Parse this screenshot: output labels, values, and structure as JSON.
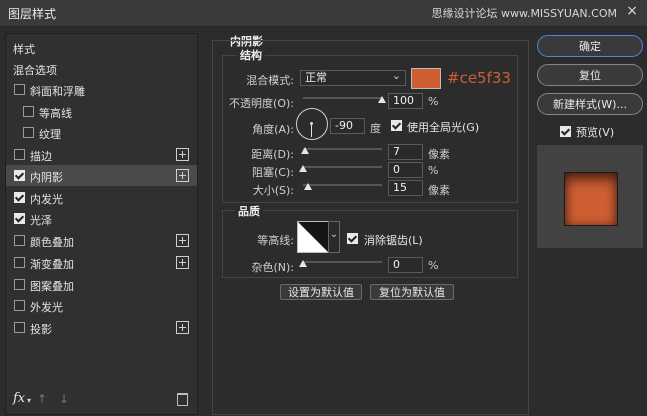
{
  "window": {
    "title": "图层样式",
    "watermark": "思缘设计论坛 www.MISSYUAN.COM",
    "close_icon": "×"
  },
  "left_panel": {
    "items": [
      {
        "label": "样式",
        "type": "header"
      },
      {
        "label": "混合选项",
        "type": "header"
      },
      {
        "label": "斜面和浮雕",
        "checked": false,
        "plus": false
      },
      {
        "label": "等高线",
        "checked": false,
        "plus": false
      },
      {
        "label": "纹理",
        "checked": false,
        "plus": false
      },
      {
        "label": "描边",
        "checked": false,
        "plus": true
      },
      {
        "label": "内阴影",
        "checked": true,
        "plus": true,
        "selected": true
      },
      {
        "label": "内发光",
        "checked": true,
        "plus": false
      },
      {
        "label": "光泽",
        "checked": true,
        "plus": false
      },
      {
        "label": "颜色叠加",
        "checked": false,
        "plus": true
      },
      {
        "label": "渐变叠加",
        "checked": false,
        "plus": true
      },
      {
        "label": "图案叠加",
        "checked": false,
        "plus": false
      },
      {
        "label": "外发光",
        "checked": false,
        "plus": false
      },
      {
        "label": "投影",
        "checked": false,
        "plus": true
      }
    ],
    "bottom": {
      "fx": "fx",
      "fx_caret": "▾",
      "up_icon": "↑",
      "down_icon": "↓",
      "trash_icon": "🗑"
    }
  },
  "panel": {
    "title": "内阴影",
    "structure": {
      "title": "结构",
      "blend_mode_label": "混合模式:",
      "blend_mode_value": "正常",
      "blend_caret": "⌄",
      "color": "#ce5f33",
      "color_text": "#ce5f33",
      "opacity_label": "不透明度(O):",
      "opacity_value": "100",
      "opacity_unit": "%",
      "opacity_fraction": 1.0,
      "angle_label": "角度(A):",
      "angle_value": "-90",
      "angle_unit": "度",
      "global_light_label": "使用全局光(G)",
      "global_light_checked": true,
      "distance_label": "距离(D):",
      "distance_value": "7",
      "distance_unit": "像素",
      "distance_fraction": 0.03,
      "choke_label": "阻塞(C):",
      "choke_value": "0",
      "choke_unit": "%",
      "choke_fraction": 0.0,
      "size_label": "大小(S):",
      "size_value": "15",
      "size_unit": "像素",
      "size_fraction": 0.06
    },
    "quality": {
      "title": "品质",
      "contour_label": "等高线:",
      "contour_caret": "⌄",
      "anti_alias_label": "消除锯齿(L)",
      "anti_alias_checked": true,
      "noise_label": "杂色(N):",
      "noise_value": "0",
      "noise_unit": "%",
      "noise_fraction": 0.0
    },
    "set_default": "设置为默认值",
    "reset_default": "复位为默认值"
  },
  "right": {
    "ok": "确定",
    "reset": "复位",
    "new_style": "新建样式(W)...",
    "preview_label": "预览(V)",
    "preview_checked": true,
    "preview_color": "#ce5f33"
  }
}
